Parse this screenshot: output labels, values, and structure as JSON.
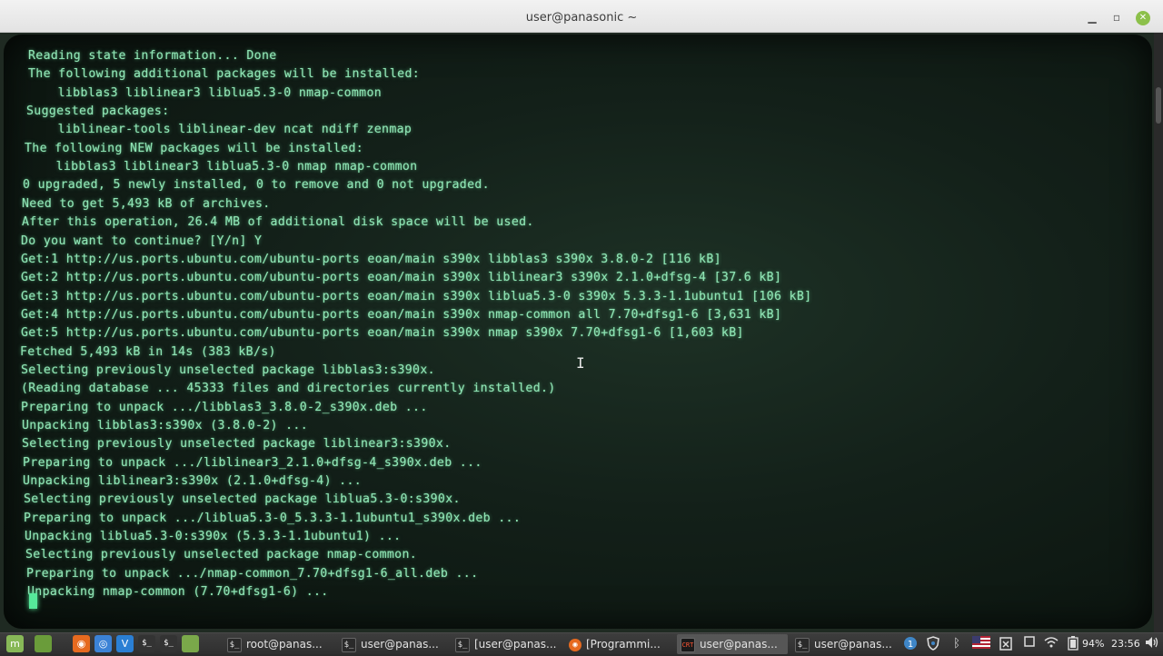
{
  "window": {
    "title": "user@panasonic ~",
    "min_glyph": "▁",
    "max_glyph": "▫",
    "close_glyph": "✕"
  },
  "terminal": {
    "lines": [
      "Reading state information... Done",
      "The following additional packages will be installed:",
      "  libblas3 liblinear3 liblua5.3-0 nmap-common",
      "Suggested packages:",
      "  liblinear-tools liblinear-dev ncat ndiff zenmap",
      "The following NEW packages will be installed:",
      "  libblas3 liblinear3 liblua5.3-0 nmap nmap-common",
      "0 upgraded, 5 newly installed, 0 to remove and 0 not upgraded.",
      "Need to get 5,493 kB of archives.",
      "After this operation, 26.4 MB of additional disk space will be used.",
      "Do you want to continue? [Y/n] Y",
      "Get:1 http://us.ports.ubuntu.com/ubuntu-ports eoan/main s390x libblas3 s390x 3.8.0-2 [116 kB]",
      "Get:2 http://us.ports.ubuntu.com/ubuntu-ports eoan/main s390x liblinear3 s390x 2.1.0+dfsg-4 [37.6 kB]",
      "Get:3 http://us.ports.ubuntu.com/ubuntu-ports eoan/main s390x liblua5.3-0 s390x 5.3.3-1.1ubuntu1 [106 kB]",
      "Get:4 http://us.ports.ubuntu.com/ubuntu-ports eoan/main s390x nmap-common all 7.70+dfsg1-6 [3,631 kB]",
      "Get:5 http://us.ports.ubuntu.com/ubuntu-ports eoan/main s390x nmap s390x 7.70+dfsg1-6 [1,603 kB]",
      "Fetched 5,493 kB in 14s (383 kB/s)",
      "Selecting previously unselected package libblas3:s390x.",
      "(Reading database ... 45333 files and directories currently installed.)",
      "Preparing to unpack .../libblas3_3.8.0-2_s390x.deb ...",
      "Unpacking libblas3:s390x (3.8.0-2) ...",
      "Selecting previously unselected package liblinear3:s390x.",
      "Preparing to unpack .../liblinear3_2.1.0+dfsg-4_s390x.deb ...",
      "Unpacking liblinear3:s390x (2.1.0+dfsg-4) ...",
      "Selecting previously unselected package liblua5.3-0:s390x.",
      "Preparing to unpack .../liblua5.3-0_5.3.3-1.1ubuntu1_s390x.deb ...",
      "Unpacking liblua5.3-0:s390x (5.3.3-1.1ubuntu1) ...",
      "Selecting previously unselected package nmap-common.",
      "Preparing to unpack .../nmap-common_7.70+dfsg1-6_all.deb ...",
      "Unpacking nmap-common (7.70+dfsg1-6) ..."
    ]
  },
  "taskbar": {
    "launchers": [
      {
        "icon": "menu-icon",
        "glyph": "m",
        "color": "#87b857"
      },
      {
        "icon": "show-desktop-icon",
        "glyph": "",
        "color": "#6a9c3a"
      },
      {
        "icon": "firefox-icon",
        "glyph": "◉",
        "color": "#e66a1f"
      },
      {
        "icon": "chrome-icon",
        "glyph": "◎",
        "color": "#3b82d6"
      },
      {
        "icon": "vscode-icon",
        "glyph": "V",
        "color": "#2a7fd4"
      },
      {
        "icon": "terminal-icon",
        "glyph": "$_",
        "color": "#333333"
      },
      {
        "icon": "terminal-alt-icon",
        "glyph": "$_",
        "color": "#333333"
      },
      {
        "icon": "files-icon",
        "glyph": "",
        "color": "#7aa84a"
      }
    ],
    "tasks": [
      {
        "label": "root@panas...",
        "icon_glyph": "$_",
        "active": false
      },
      {
        "label": "user@panas...",
        "icon_glyph": "$_",
        "active": false
      },
      {
        "label": "[user@panas...",
        "icon_glyph": "$_",
        "active": false
      },
      {
        "label": "[Programmi...",
        "icon_glyph": "◉",
        "active": false
      },
      {
        "label": "user@panas...",
        "icon_glyph": "CRT",
        "active": true
      },
      {
        "label": "user@panas...",
        "icon_glyph": "$_",
        "active": false
      }
    ],
    "tray": {
      "battery": "94%",
      "clock": "23:56"
    }
  }
}
